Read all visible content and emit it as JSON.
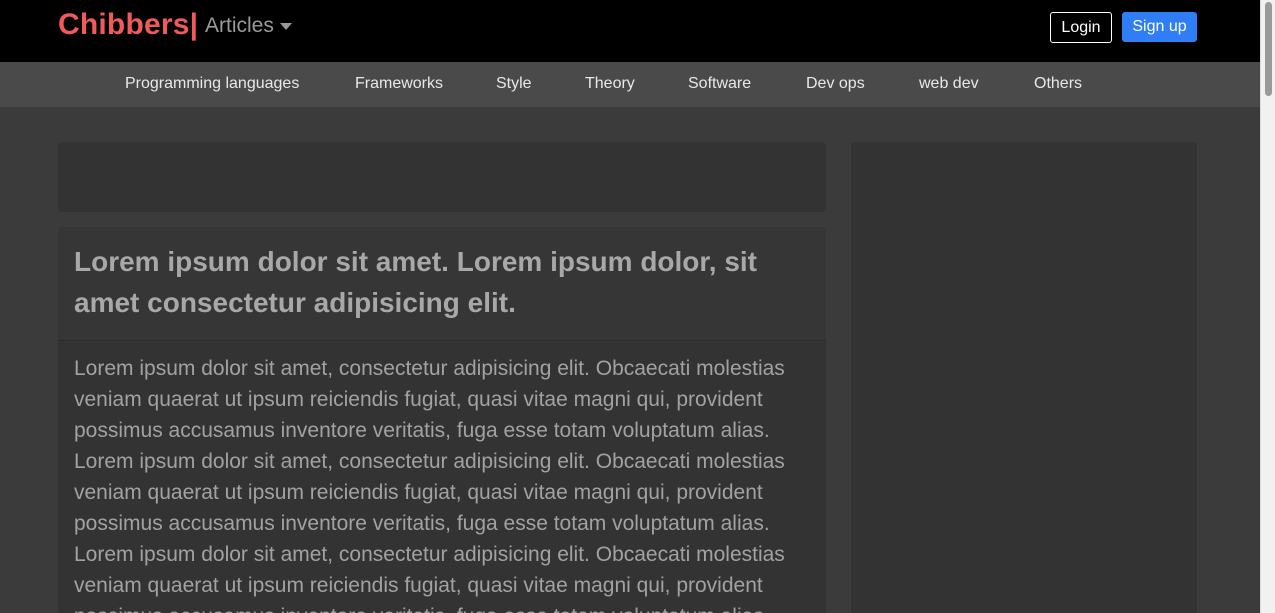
{
  "navbar": {
    "brand": "Chibbers|",
    "articles_label": "Articles",
    "login_label": "Login",
    "signup_label": "Sign up"
  },
  "categories": [
    "Programming languages",
    "Frameworks",
    "Style",
    "Theory",
    "Software",
    "Dev ops",
    "web dev",
    "Others"
  ],
  "article": {
    "title": "Lorem ipsum dolor sit amet. Lorem ipsum dolor, sit amet consectetur adipisicing elit.",
    "body": "Lorem ipsum dolor sit amet, consectetur adipisicing elit. Obcaecati molestias veniam quaerat ut ipsum reiciendis fugiat, quasi vitae magni qui, provident possimus accusamus inventore veritatis, fuga esse totam voluptatum alias. Lorem ipsum dolor sit amet, consectetur adipisicing elit. Obcaecati molestias veniam quaerat ut ipsum reiciendis fugiat, quasi vitae magni qui, provident possimus accusamus inventore veritatis, fuga esse totam voluptatum alias. Lorem ipsum dolor sit amet, consectetur adipisicing elit. Obcaecati molestias veniam quaerat ut ipsum reiciendis fugiat, quasi vitae magni qui, provident possimus accusamus inventore veritatis, fuga esse totam voluptatum alias."
  },
  "colors": {
    "brand": "#f05a5a",
    "signup": "#2f7ef6",
    "navbar": "#000000",
    "catbar": "#4a4a4a",
    "background": "#3b3b3b",
    "card": "#333333"
  },
  "icons": {
    "articles_caret": "caret-down-icon"
  }
}
